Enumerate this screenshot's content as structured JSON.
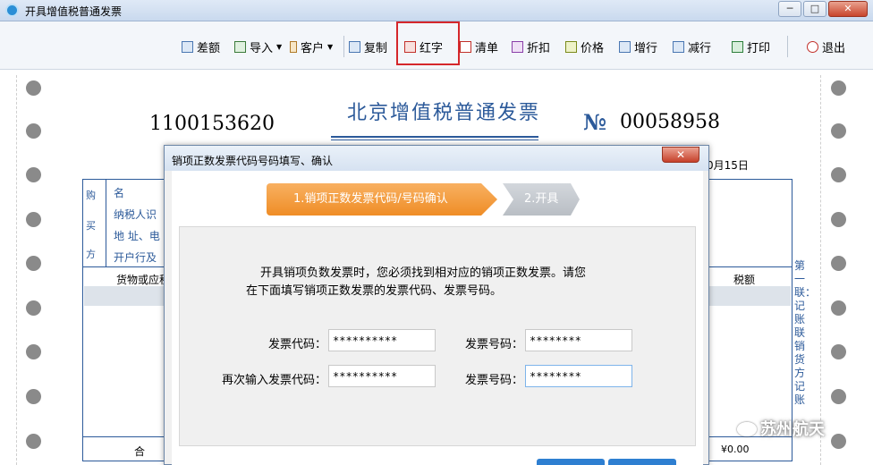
{
  "window": {
    "title": "开具增值税普通发票",
    "controls": {
      "minimize": "─",
      "maximize": "□",
      "close": "✕"
    }
  },
  "toolbar": {
    "items": [
      {
        "label": "差额",
        "icon": "diff-amount-icon"
      },
      {
        "label": "导入",
        "icon": "import-icon",
        "dropdown": true
      },
      {
        "label": "客户",
        "icon": "customer-icon",
        "dropdown": true
      },
      {
        "label": "复制",
        "icon": "copy-icon"
      },
      {
        "label": "红字",
        "icon": "red-invoice-icon",
        "highlighted": true
      },
      {
        "label": "清单",
        "icon": "list-icon"
      },
      {
        "label": "折扣",
        "icon": "discount-icon"
      },
      {
        "label": "价格",
        "icon": "price-icon"
      },
      {
        "label": "增行",
        "icon": "add-row-icon"
      },
      {
        "label": "减行",
        "icon": "remove-row-icon"
      },
      {
        "label": "打印",
        "icon": "print-icon"
      },
      {
        "label": "退出",
        "icon": "power-icon"
      }
    ],
    "highlight_color": "#d5272b"
  },
  "invoice": {
    "code": "1100153620",
    "title": "北京增值税普通发票",
    "no_mark": "№",
    "number": "00058958",
    "date_fragment": "0月15日",
    "buyer_label": [
      "购",
      "买",
      "方"
    ],
    "buyer_fields": [
      "名",
      "纳税人识",
      "地 址、电",
      "开户行及"
    ],
    "columns": {
      "goods": "货物或应税",
      "tax": "税额"
    },
    "stub_text": "第一联：记账联 销货方记账",
    "total_label": "合",
    "total_value": "¥0.00",
    "accent_color": "#2c5a9a"
  },
  "dialog": {
    "title": "销项正数发票代码号码填写、确认",
    "close": "✕",
    "steps": [
      "1.销项正数发票代码/号码确认",
      "2.开具"
    ],
    "message_line1": "开具销项负数发票时，您必须找到相对应的销项正数发票。请您",
    "message_line2": "在下面填写销项正数发票的发票代码、发票号码。",
    "fields": {
      "code_label": "发票代码：",
      "code_value": "**********",
      "number_label": "发票号码：",
      "number_value": "********",
      "code_confirm_label": "再次输入发票代码：",
      "code_confirm_value": "**********",
      "number_confirm_label": "发票号码：",
      "number_confirm_value": "********"
    },
    "step_active_color": "#ef8d26"
  },
  "watermark": {
    "text": "苏州航天"
  }
}
